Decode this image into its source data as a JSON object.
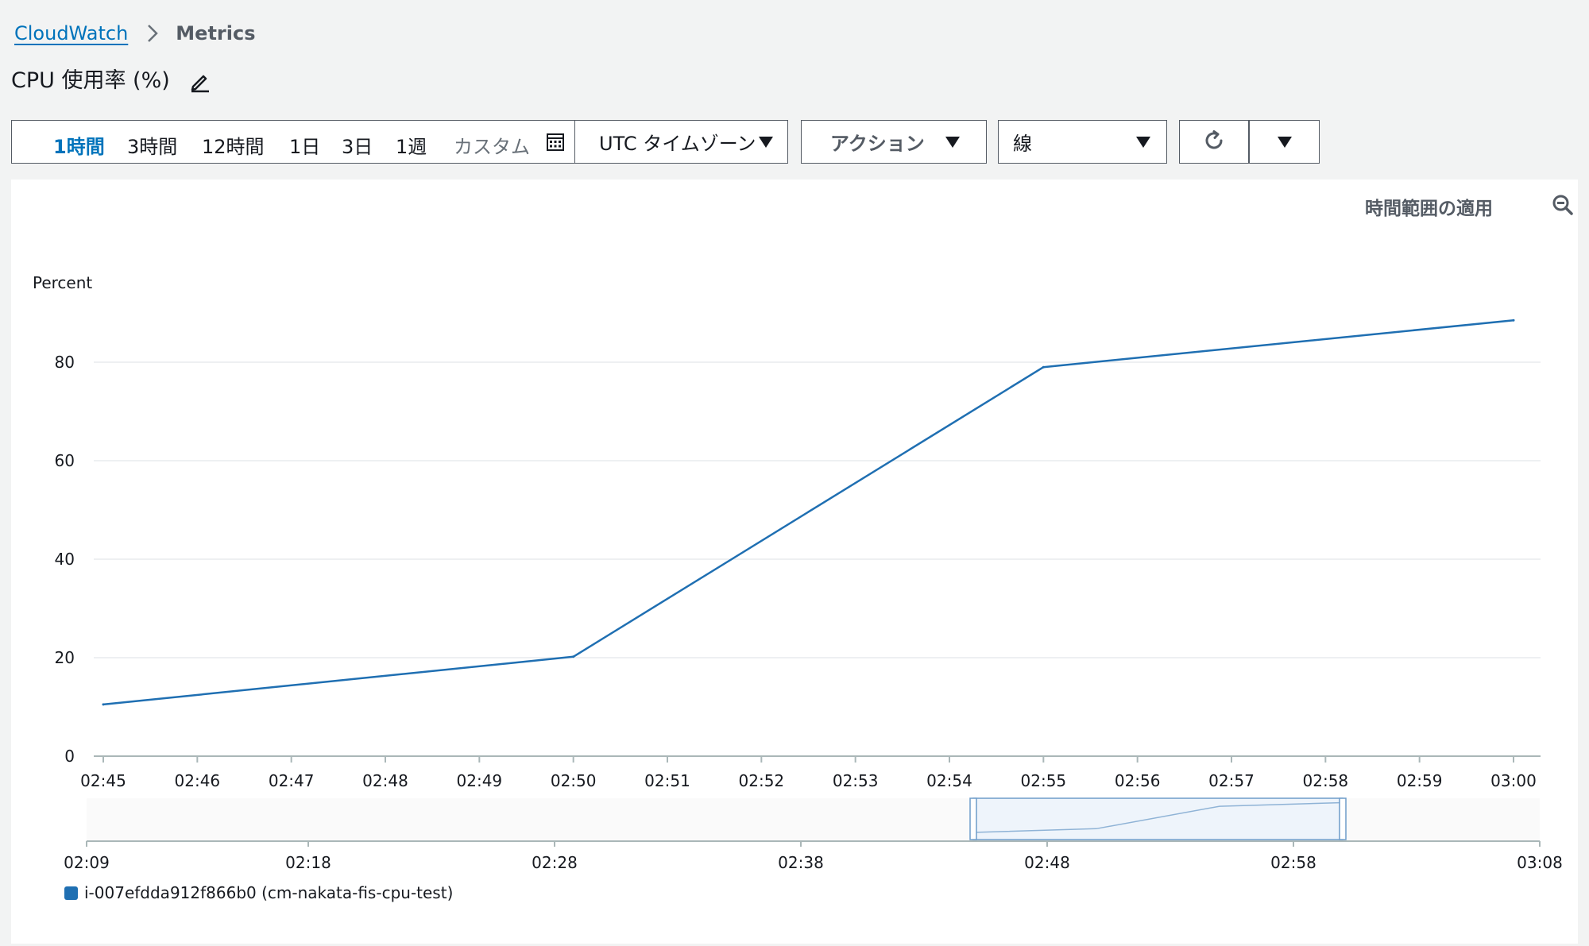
{
  "breadcrumb": {
    "root": "CloudWatch",
    "current": "Metrics"
  },
  "page": {
    "title": "CPU 使用率 (%)"
  },
  "toolbar": {
    "ranges": [
      {
        "label": "1時間",
        "active": true
      },
      {
        "label": "3時間",
        "active": false
      },
      {
        "label": "12時間",
        "active": false
      },
      {
        "label": "1日",
        "active": false
      },
      {
        "label": "3日",
        "active": false
      },
      {
        "label": "1週",
        "active": false
      }
    ],
    "custom_label": "カスタム",
    "timezone": "UTC タイムゾーン",
    "actions": "アクション",
    "line_type": "線"
  },
  "panel": {
    "apply_range": "時間範囲の適用"
  },
  "colors": {
    "accent": "#0073bb",
    "series": "#1f6fb2",
    "background": "#f2f3f3"
  },
  "icons": {
    "breadcrumb_separator": "chevron-right-icon",
    "edit": "pencil-icon",
    "calendar": "calendar-icon",
    "refresh": "refresh-icon",
    "zoom_out": "zoom-out-icon"
  },
  "chart_data": {
    "type": "line",
    "ylabel": "Percent",
    "ylim": [
      0,
      80
    ],
    "yticks": [
      0,
      20,
      40,
      60,
      80
    ],
    "x": [
      "02:45",
      "02:50",
      "02:55",
      "03:00"
    ],
    "xticks": [
      "02:45",
      "02:46",
      "02:47",
      "02:48",
      "02:49",
      "02:50",
      "02:51",
      "02:52",
      "02:53",
      "02:54",
      "02:55",
      "02:56",
      "02:57",
      "02:58",
      "02:59",
      "03:00"
    ],
    "series": [
      {
        "name": "i-007efdda912f866b0 (cm-nakata-fis-cpu-test)",
        "values": [
          10.5,
          20.2,
          79.0,
          88.5
        ]
      }
    ],
    "grid": true,
    "legend": "bottom-left",
    "overview": {
      "xticks": [
        "02:09",
        "02:18",
        "02:28",
        "02:38",
        "02:48",
        "02:58",
        "03:08"
      ],
      "selection": [
        "02:45",
        "03:00"
      ]
    }
  }
}
